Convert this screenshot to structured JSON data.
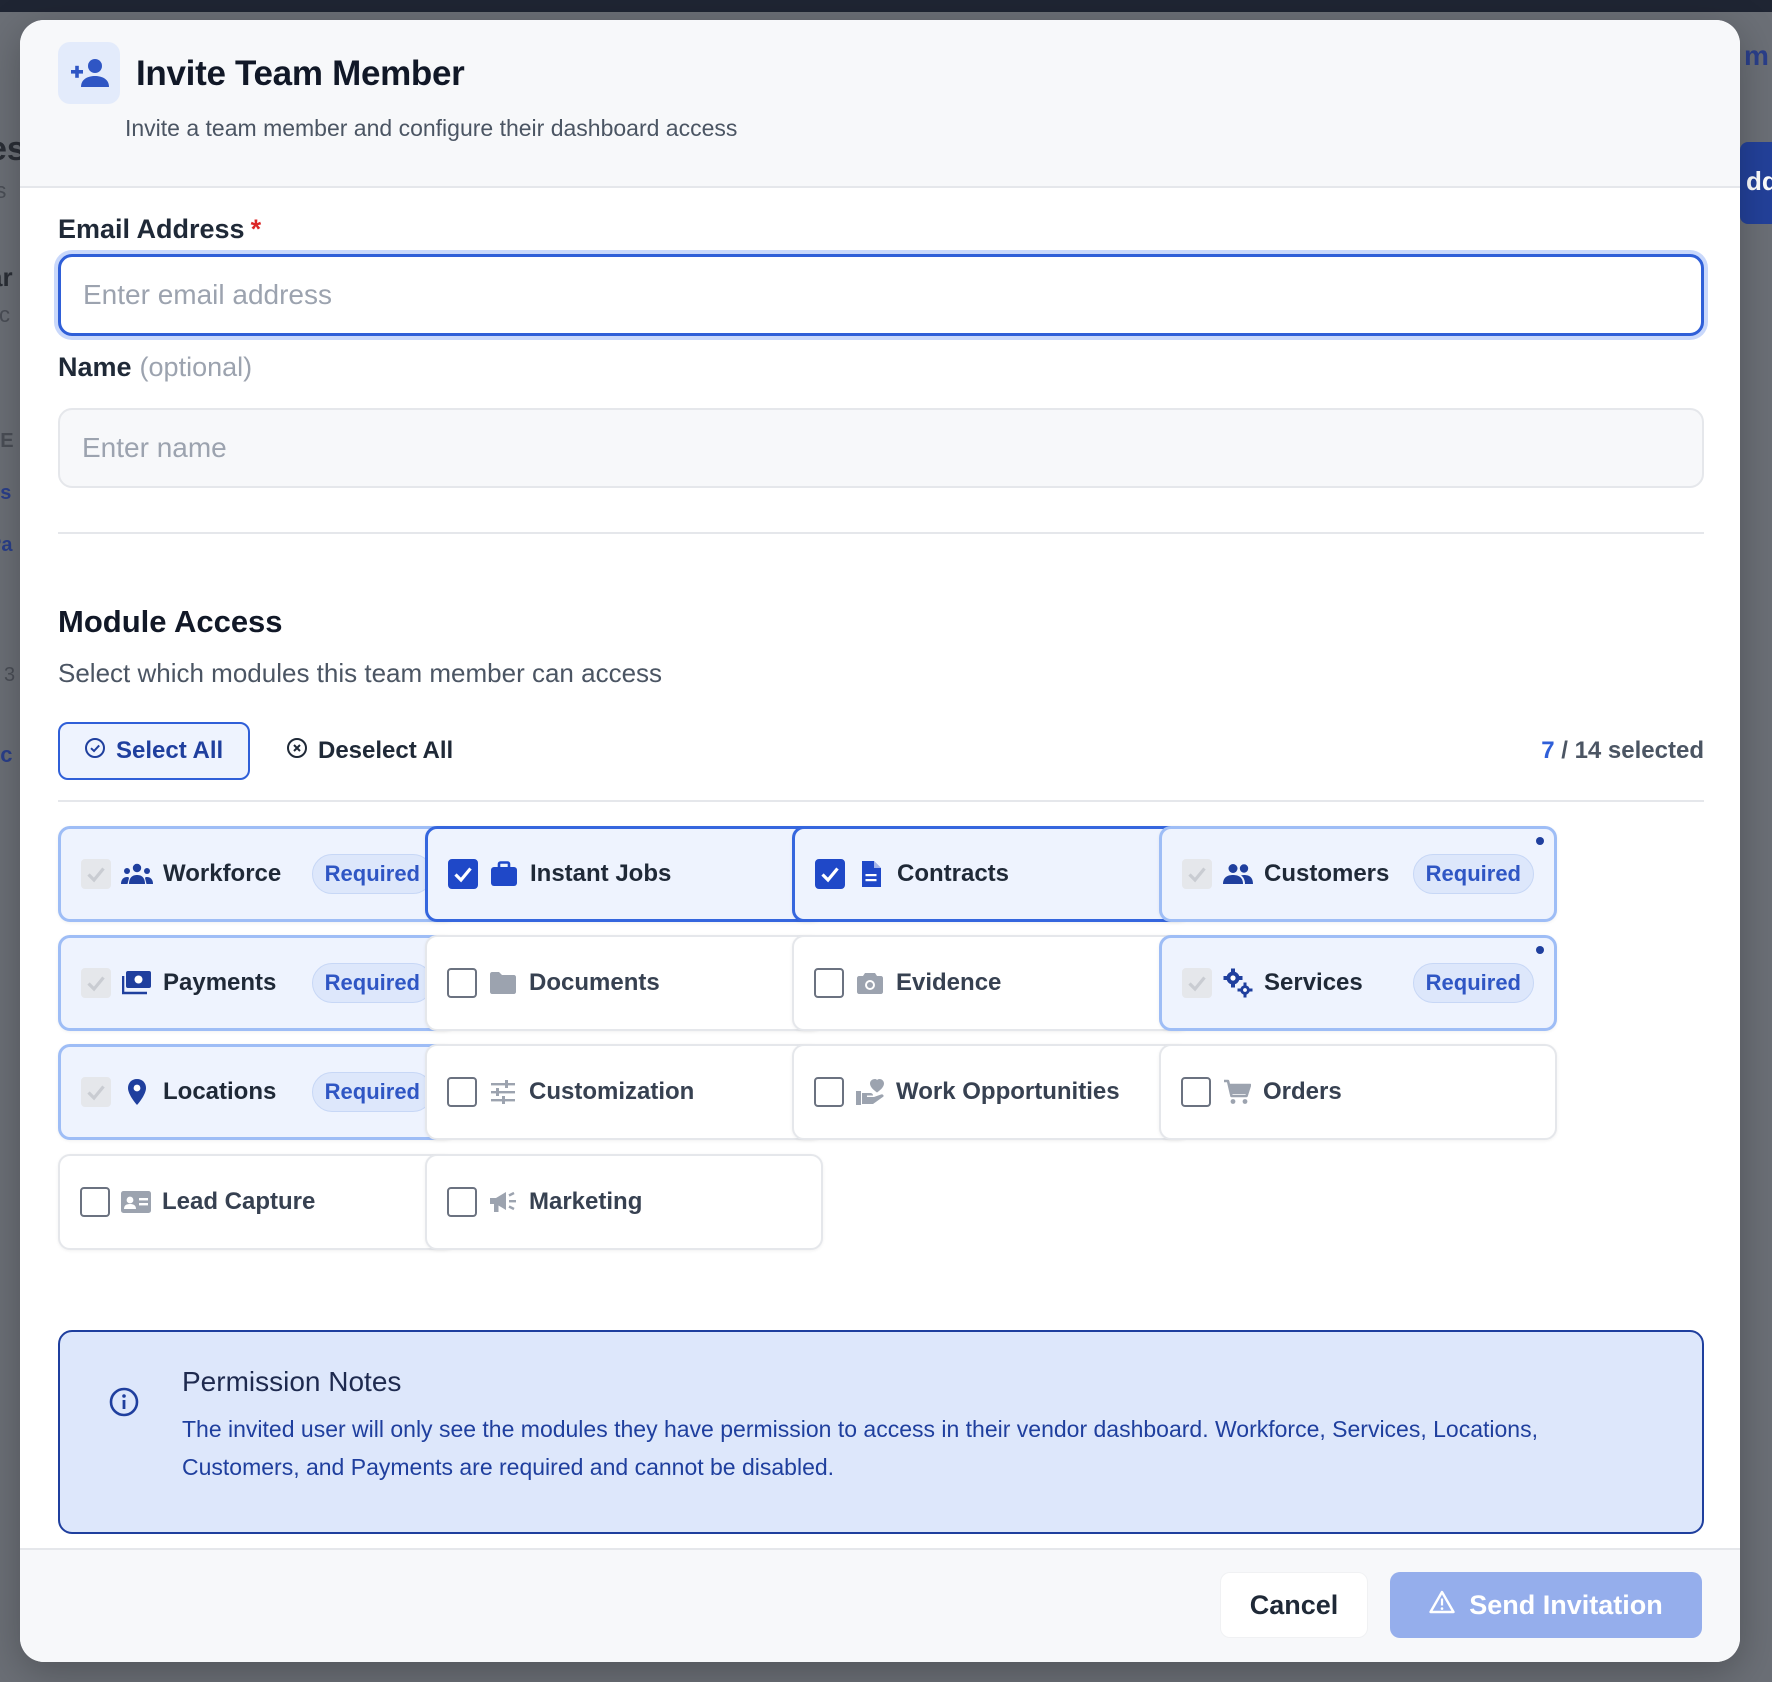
{
  "background": {
    "left_fragments": [
      "es",
      "rs",
      "ar",
      "sc",
      "LE",
      "ns",
      "Pa",
      "3",
      "cc"
    ],
    "right_top_fragment": "m",
    "right_button_fragment": "dd"
  },
  "modal": {
    "title": "Invite Team Member",
    "subtitle": "Invite a team member and configure their dashboard access",
    "header_icon": "person-add-icon"
  },
  "form": {
    "email": {
      "label": "Email Address",
      "required_mark": "*",
      "placeholder": "Enter email address",
      "value": ""
    },
    "name": {
      "label": "Name",
      "optional_text": "(optional)",
      "placeholder": "Enter name",
      "value": ""
    }
  },
  "module_access": {
    "title": "Module Access",
    "description": "Select which modules this team member can access",
    "select_all_label": "Select All",
    "deselect_all_label": "Deselect All",
    "selected_count": "7",
    "total_label": "/ 14 selected",
    "required_badge": "Required",
    "modules": [
      {
        "name": "Workforce",
        "icon": "group-icon",
        "state": "required",
        "checked": true
      },
      {
        "name": "Instant Jobs",
        "icon": "briefcase-icon",
        "state": "selected",
        "checked": true
      },
      {
        "name": "Contracts",
        "icon": "document-icon",
        "state": "selected",
        "checked": true
      },
      {
        "name": "Customers",
        "icon": "people-icon",
        "state": "required",
        "checked": true
      },
      {
        "name": "Payments",
        "icon": "payments-icon",
        "state": "required",
        "checked": true
      },
      {
        "name": "Documents",
        "icon": "folder-icon",
        "state": "plain",
        "checked": false
      },
      {
        "name": "Evidence",
        "icon": "camera-icon",
        "state": "plain",
        "checked": false
      },
      {
        "name": "Services",
        "icon": "gears-icon",
        "state": "required",
        "checked": true
      },
      {
        "name": "Locations",
        "icon": "location-pin-icon",
        "state": "required",
        "checked": true
      },
      {
        "name": "Customization",
        "icon": "sliders-icon",
        "state": "plain",
        "checked": false
      },
      {
        "name": "Work Opportunities",
        "icon": "volunteer-icon",
        "state": "plain",
        "checked": false
      },
      {
        "name": "Orders",
        "icon": "cart-icon",
        "state": "plain",
        "checked": false
      },
      {
        "name": "Lead Capture",
        "icon": "contact-card-icon",
        "state": "plain",
        "checked": false
      },
      {
        "name": "Marketing",
        "icon": "megaphone-icon",
        "state": "plain",
        "checked": false
      }
    ]
  },
  "notes": {
    "title": "Permission Notes",
    "text": "The invited user will only see the modules they have permission to access in their vendor dashboard. Workforce, Services, Locations, Customers, and Payments are required and cannot be disabled."
  },
  "footer": {
    "cancel_label": "Cancel",
    "send_label": "Send Invitation"
  },
  "colors": {
    "accent": "#2f5fd8",
    "accent_dark": "#1f3f9e",
    "required_bg": "#eef3fe",
    "send_disabled": "#95aeec",
    "danger": "#dc2626"
  }
}
